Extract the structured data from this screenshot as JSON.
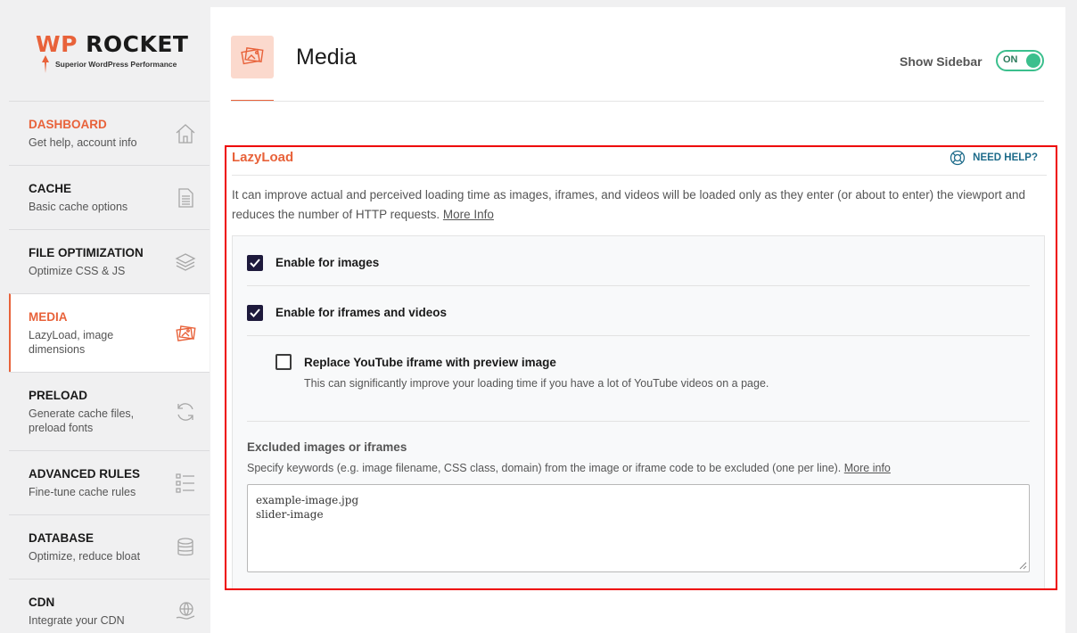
{
  "brand": {
    "name_wp": "WP",
    "name_rest": "ROCKET",
    "tagline": "Superior WordPress Performance"
  },
  "sidebar": {
    "items": [
      {
        "title": "DASHBOARD",
        "subtitle": "Get help, account info",
        "icon": "home-icon"
      },
      {
        "title": "CACHE",
        "subtitle": "Basic cache options",
        "icon": "file-icon"
      },
      {
        "title": "FILE OPTIMIZATION",
        "subtitle": "Optimize CSS & JS",
        "icon": "layers-icon"
      },
      {
        "title": "MEDIA",
        "subtitle": "LazyLoad, image dimensions",
        "icon": "images-icon"
      },
      {
        "title": "PRELOAD",
        "subtitle": "Generate cache files, preload fonts",
        "icon": "refresh-icon"
      },
      {
        "title": "ADVANCED RULES",
        "subtitle": "Fine-tune cache rules",
        "icon": "list-icon"
      },
      {
        "title": "DATABASE",
        "subtitle": "Optimize, reduce bloat",
        "icon": "database-icon"
      },
      {
        "title": "CDN",
        "subtitle": "Integrate your CDN",
        "icon": "globe-hand-icon"
      }
    ]
  },
  "header": {
    "title": "Media",
    "show_sidebar_label": "Show Sidebar",
    "toggle_label": "ON"
  },
  "lazyload": {
    "title": "LazyLoad",
    "need_help": "NEED HELP?",
    "description": "It can improve actual and perceived loading time as images, iframes, and videos will be loaded only as they enter (or about to enter) the viewport and reduces the number of HTTP requests.",
    "more_info": "More Info",
    "options": {
      "images_label": "Enable for images",
      "images_checked": true,
      "iframes_label": "Enable for iframes and videos",
      "iframes_checked": true,
      "youtube_label": "Replace YouTube iframe with preview image",
      "youtube_desc": "This can significantly improve your loading time if you have a lot of YouTube videos on a page.",
      "youtube_checked": false
    },
    "excluded": {
      "title": "Excluded images or iframes",
      "description": "Specify keywords (e.g. image filename, CSS class, domain) from the image or iframe code to be excluded (one per line).",
      "more_info": "More info",
      "lines": [
        "example-image.jpg",
        "slider-image"
      ]
    }
  },
  "colors": {
    "accent": "#e8623a",
    "toggle": "#3bbf8d",
    "highlight_box": "#e00000",
    "checkbox": "#1e1a3c"
  }
}
